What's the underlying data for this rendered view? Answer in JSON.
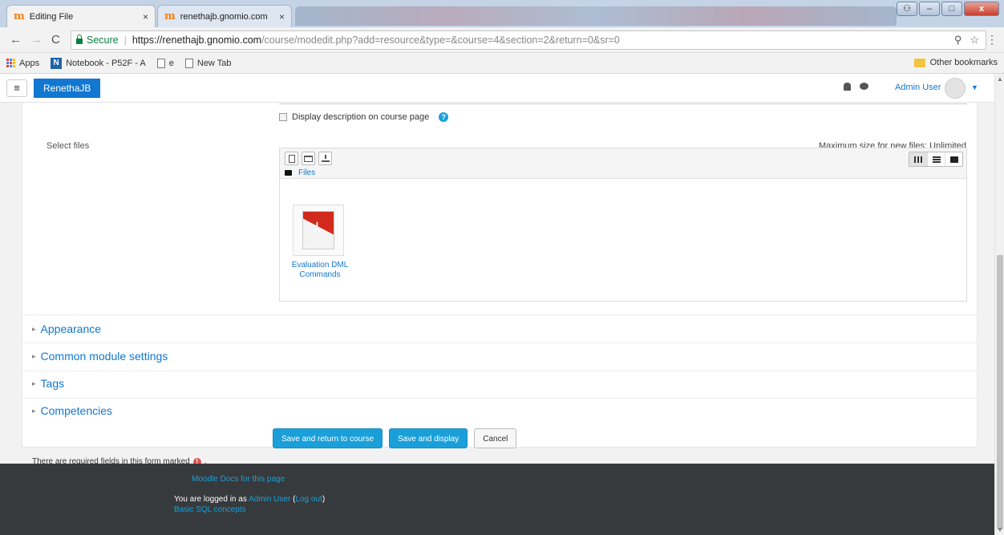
{
  "browser": {
    "tabs": [
      {
        "title": "Editing File",
        "active": true
      },
      {
        "title": "renethajb.gnomio.com",
        "active": false
      }
    ],
    "url": {
      "secure_label": "Secure",
      "host": "https://renethajb.gnomio.com",
      "path": "/course/modedit.php?add=resource&type=&course=4&section=2&return=0&sr=0"
    },
    "bookmarks": [
      {
        "label": "Apps",
        "icon": "apps-icon"
      },
      {
        "label": "Notebook - P52F - A",
        "icon": "notebook-icon"
      },
      {
        "label": "e",
        "icon": "page-icon"
      },
      {
        "label": "New Tab",
        "icon": "page-icon"
      }
    ],
    "other_bookmarks": "Other bookmarks"
  },
  "navbar": {
    "brand": "RenethaJB",
    "user": "Admin User"
  },
  "form": {
    "display_description_label": "Display description on course page",
    "select_files_label": "Select files",
    "max_size": "Maximum size for new files: Unlimited",
    "path_label": "Files",
    "file_name": "Evaluation DML Commands",
    "sections": [
      "Appearance",
      "Common module settings",
      "Tags",
      "Competencies"
    ],
    "buttons": {
      "save_return": "Save and return to course",
      "save_display": "Save and display",
      "cancel": "Cancel"
    },
    "required_note": "There are required fields in this form marked",
    "required_note_suffix": "."
  },
  "footer": {
    "docs_link": "Moodle Docs for this page",
    "logged_in_prefix": "You are logged in as",
    "logged_in_user": "Admin User",
    "logout_open": "(",
    "logout": "Log out",
    "logout_close": ")",
    "course_link": "Basic SQL concepts"
  },
  "colors": {
    "accent": "#1177d1",
    "button": "#1a9fd9",
    "footer_bg": "#373a3c",
    "required": "#d9534f"
  }
}
